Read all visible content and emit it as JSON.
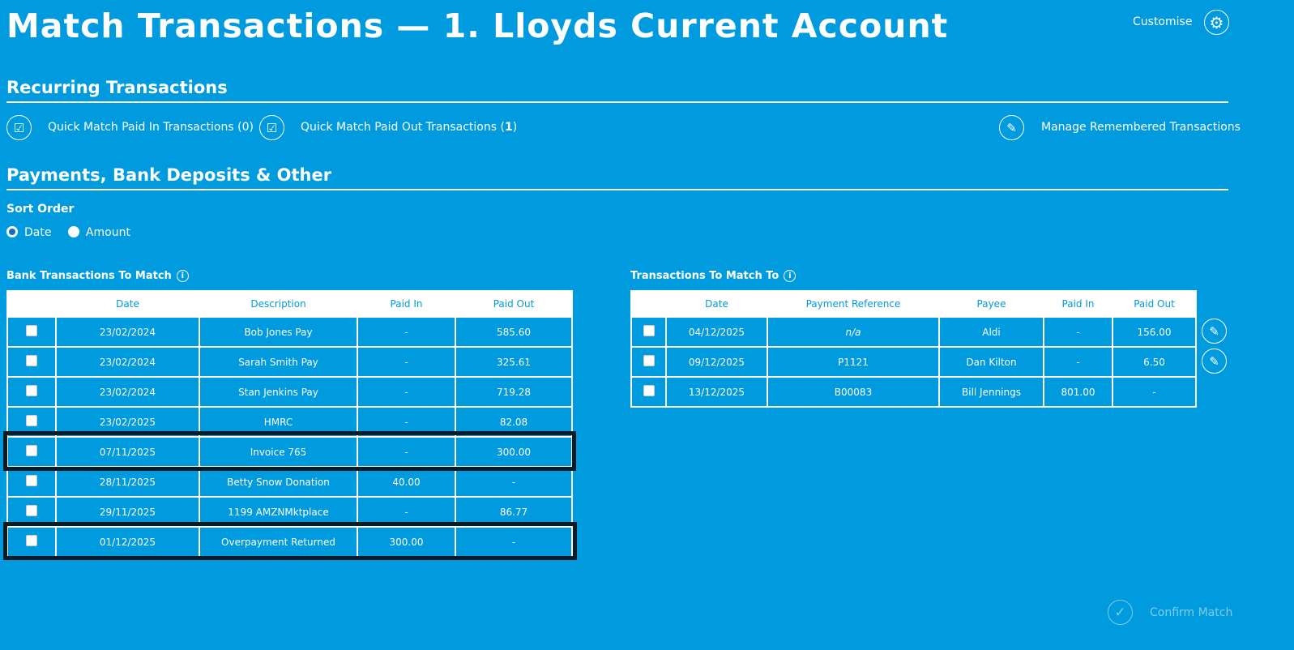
{
  "title": "Match Transactions — 1. Lloyds Current Account",
  "customise": "Customise",
  "recurring": {
    "heading": "Recurring Transactions",
    "quick_in": "Quick Match Paid In Transactions (0)",
    "quick_out": "Quick Match Paid Out Transactions (",
    "quick_out_count": "1",
    "quick_out_end": ")",
    "manage": "Manage Remembered Transactions"
  },
  "payments": {
    "heading": "Payments, Bank Deposits & Other",
    "sort_label": "Sort Order",
    "sort_options": [
      "Date",
      "Amount"
    ],
    "sort_selected": "Date"
  },
  "bank": {
    "title": "Bank Transactions To Match",
    "headers": [
      "Date",
      "Description",
      "Paid In",
      "Paid Out"
    ],
    "rows": [
      [
        "23/02/2024",
        "Bob Jones Pay",
        "-",
        "585.60"
      ],
      [
        "23/02/2024",
        "Sarah Smith Pay",
        "-",
        "325.61"
      ],
      [
        "23/02/2024",
        "Stan Jenkins Pay",
        "-",
        "719.28"
      ],
      [
        "23/02/2025",
        "HMRC",
        "-",
        "82.08"
      ],
      [
        "07/11/2025",
        "Invoice 765",
        "-",
        "300.00"
      ],
      [
        "28/11/2025",
        "Betty Snow Donation",
        "40.00",
        "-"
      ],
      [
        "29/11/2025",
        "1199 AMZNMktplace",
        "-",
        "86.77"
      ],
      [
        "01/12/2025",
        "Overpayment Returned",
        "300.00",
        "-"
      ]
    ]
  },
  "match": {
    "title": "Transactions To Match To",
    "headers": [
      "Date",
      "Payment Reference",
      "Payee",
      "Paid In",
      "Paid Out"
    ],
    "rows": [
      [
        "04/12/2025",
        "n/a",
        "Aldi",
        "-",
        "156.00"
      ],
      [
        "09/12/2025",
        "P1121",
        "Dan Kilton",
        "-",
        "6.50"
      ],
      [
        "13/12/2025",
        "B00083",
        "Bill Jennings",
        "801.00",
        "-"
      ]
    ]
  },
  "confirm": "Confirm Match"
}
